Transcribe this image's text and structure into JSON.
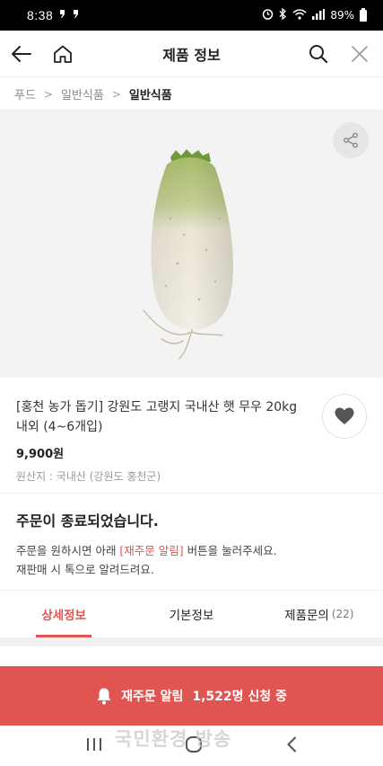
{
  "status_bar": {
    "time": "8:38",
    "indicators": ") )",
    "battery": "89%"
  },
  "header": {
    "title": "제품 정보"
  },
  "breadcrumb": {
    "items": [
      "푸드",
      "일반식품",
      "일반식품"
    ]
  },
  "product": {
    "name": "[홍천 농가 돕기] 강원도 고랭지 국내산 햇 무우 20kg 내외 (4~6개입)",
    "price": "9,900원",
    "origin": "원산지 : 국내산 (강원도 홍천군)"
  },
  "order_status": {
    "headline": "주문이 종료되었습니다.",
    "line1_before": "주문을 원하시면 아래 ",
    "line1_highlight": "[재주문 알림]",
    "line1_after": " 버튼을 눌러주세요.",
    "line2": "재판매 시 톡으로 알려드려요."
  },
  "tabs": [
    {
      "label": "상세정보",
      "active": true
    },
    {
      "label": "기본정보",
      "active": false
    },
    {
      "label": "제품문의",
      "count": "(22)",
      "active": false
    }
  ],
  "reorder": {
    "label": "재주문 알림",
    "applicants": "1,522명 신청 중"
  },
  "watermark": "국민환경 방송",
  "colors": {
    "accent": "#e05552",
    "image_bg": "#f3f3f3"
  },
  "icons": [
    "back-arrow-icon",
    "home-icon",
    "search-icon",
    "close-icon",
    "share-icon",
    "heart-icon",
    "bell-icon",
    "recent-apps-icon",
    "home-nav-icon",
    "back-nav-icon"
  ]
}
